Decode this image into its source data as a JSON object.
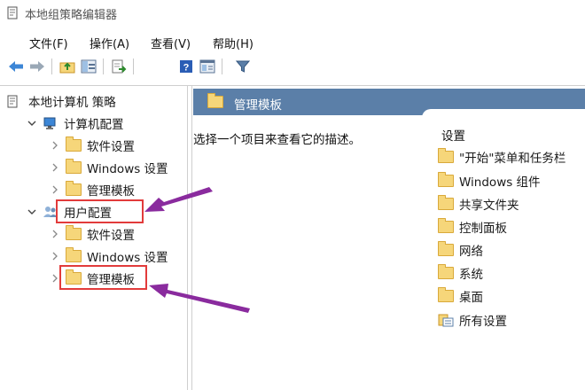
{
  "window": {
    "title": "本地组策略编辑器"
  },
  "menu": [
    "文件(F)",
    "操作(A)",
    "查看(V)",
    "帮助(H)"
  ],
  "toolbar": [
    "back-icon",
    "forward-icon",
    "up-folder-icon",
    "show-hide-tree-icon",
    "export-list-icon",
    "help-icon",
    "properties-icon",
    "filter-icon"
  ],
  "tree": {
    "root": "本地计算机 策略",
    "computer": "计算机配置",
    "computer_children": [
      "软件设置",
      "Windows 设置",
      "管理模板"
    ],
    "user": "用户配置",
    "user_children": [
      "软件设置",
      "Windows 设置",
      "管理模板"
    ]
  },
  "right": {
    "header": "管理模板",
    "description": "选择一个项目来查看它的描述。",
    "column_header": "设置",
    "items": [
      "\"开始\"菜单和任务栏",
      "Windows 组件",
      "共享文件夹",
      "控制面板",
      "网络",
      "系统",
      "桌面",
      "所有设置"
    ]
  },
  "colors": {
    "header_blue": "#5b7fa8",
    "highlight_red": "#e23b3b",
    "arrow_purple": "#8a2b9e",
    "folder_yellow": "#f6d67a"
  }
}
